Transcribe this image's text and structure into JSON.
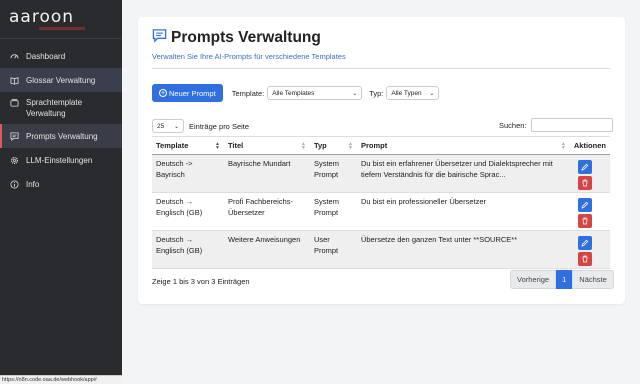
{
  "brand": {
    "logo": "aaroon"
  },
  "sidebar": {
    "items": [
      {
        "label": "Dashboard",
        "icon": "dashboard-icon"
      },
      {
        "label": "Glossar Verwaltung",
        "icon": "book-icon"
      },
      {
        "label": "Sprachtemplate Verwaltung",
        "icon": "template-icon"
      },
      {
        "label": "Prompts Verwaltung",
        "icon": "chat-icon"
      },
      {
        "label": "LLM-Einstellungen",
        "icon": "gear-icon"
      },
      {
        "label": "Info",
        "icon": "info-icon"
      }
    ]
  },
  "statusbar": {
    "url": "https://n8n.code.oaa.de/webhook/app#"
  },
  "page": {
    "title": "Prompts Verwaltung",
    "subtitle": "Verwalten Sie Ihre AI-Prompts für verschiedene Templates"
  },
  "toolbar": {
    "new_prompt": "Neuer Prompt",
    "template_label": "Template:",
    "template_value": "Alle Templates",
    "type_label": "Typ:",
    "type_value": "Alle Typen"
  },
  "table_controls": {
    "page_length": "25",
    "page_length_label": "Einträge pro Seite",
    "search_label": "Suchen:",
    "search_value": ""
  },
  "table": {
    "columns": [
      "Template",
      "Titel",
      "Typ",
      "Prompt",
      "Aktionen"
    ],
    "rows": [
      {
        "template": "Deutsch -> Bayrisch",
        "titel": "Bayrische Mundart",
        "typ": "System Prompt",
        "prompt": "Du bist ein erfahrener Übersetzer und Dialektsprecher mit tiefem Verständnis für die bairische Sprac..."
      },
      {
        "template": "Deutsch → Englisch (GB)",
        "titel": "Profi Fachbereichs-Übersetzer",
        "typ": "System Prompt",
        "prompt": "Du bist ein professioneller Übersetzer"
      },
      {
        "template": "Deutsch → Englisch (GB)",
        "titel": "Weitere Anweisungen",
        "typ": "User Prompt",
        "prompt": "Übersetze den ganzen Text unter **SOURCE**"
      }
    ]
  },
  "footer": {
    "info": "Zeige 1 bis 3 von 3 Einträgen",
    "prev": "Vorherige",
    "current_page": "1",
    "next": "Nächste"
  },
  "colors": {
    "primary": "#2f6fe0",
    "danger": "#d64545",
    "sidebar": "#2a2b2e"
  }
}
